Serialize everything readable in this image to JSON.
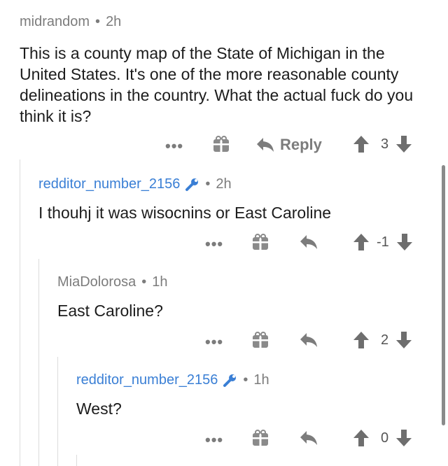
{
  "comments": [
    {
      "username": "midrandom",
      "age": "2h",
      "body": "This is a county map of the State of  Michigan in the United States. It's one of the more reasonable county delineations in the country.  What the actual fuck do you think it is?",
      "reply_label": "Reply",
      "score": "3"
    },
    {
      "username": "redditor_number_2156",
      "age": "2h",
      "body": "I thouhj it was wisocnins or East Caroline",
      "score": "-1"
    },
    {
      "username": "MiaDolorosa",
      "age": "1h",
      "body": "East Caroline?",
      "score": "2"
    },
    {
      "username": "redditor_number_2156",
      "age": "1h",
      "body": "West?",
      "score": "0"
    }
  ],
  "meta_separator": "•",
  "more_glyph": "•••",
  "icons": {
    "more": "more-dots-icon",
    "gift": "gift-icon",
    "reply": "reply-arrow-icon",
    "upvote": "upvote-arrow-icon",
    "downvote": "downvote-arrow-icon",
    "mod": "wrench-icon"
  },
  "colors": {
    "username_highlight": "#3a7fd5",
    "meta_gray": "#7c7c7c",
    "text": "#1c1c1c",
    "icon_gray": "#8a8a8a"
  }
}
